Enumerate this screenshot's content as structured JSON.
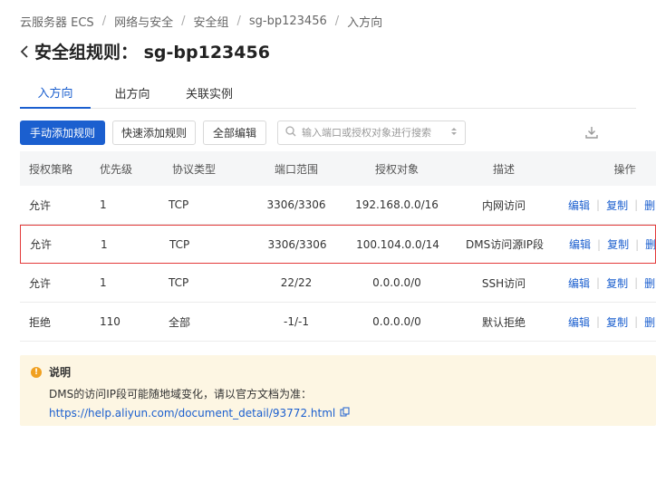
{
  "breadcrumb": [
    "云服务器 ECS",
    "网络与安全",
    "安全组",
    "sg-bp123456",
    "入方向"
  ],
  "title": "安全组规则： sg-bp123456",
  "tabs": [
    {
      "label": "入方向",
      "active": true
    },
    {
      "label": "出方向",
      "active": false
    },
    {
      "label": "关联实例",
      "active": false
    }
  ],
  "toolbar": {
    "manual_add": "手动添加规则",
    "quick_add": "快速添加规则",
    "edit_all": "全部编辑",
    "search_placeholder": "输入端口或授权对象进行搜索"
  },
  "table": {
    "headers": {
      "policy": "授权策略",
      "priority": "优先级",
      "protocol": "协议类型",
      "port": "端口范围",
      "object": "授权对象",
      "desc": "描述",
      "ops": "操作"
    },
    "rows": [
      {
        "policy": "允许",
        "priority": "1",
        "protocol": "TCP",
        "port": "3306/3306",
        "object": "192.168.0.0/16",
        "desc": "内网访问",
        "highlight": false
      },
      {
        "policy": "允许",
        "priority": "1",
        "protocol": "TCP",
        "port": "3306/3306",
        "object": "100.104.0.0/14",
        "desc": "DMS访问源IP段",
        "highlight": true
      },
      {
        "policy": "允许",
        "priority": "1",
        "protocol": "TCP",
        "port": "22/22",
        "object": "0.0.0.0/0",
        "desc": "SSH访问",
        "highlight": false
      },
      {
        "policy": "拒绝",
        "priority": "110",
        "protocol": "全部",
        "port": "-1/-1",
        "object": "0.0.0.0/0",
        "desc": "默认拒绝",
        "highlight": false
      }
    ],
    "ops": {
      "edit": "编辑",
      "copy": "复制",
      "delete": "删除"
    }
  },
  "notice": {
    "title": "说明",
    "text": "DMS的访问IP段可能随地域变化，请以官方文档为准：",
    "link": "https://help.aliyun.com/document_detail/93772.html"
  },
  "colors": {
    "primary": "#1b5fcf",
    "highlight": "#e33a3a",
    "notice_bg": "#fdf6e3",
    "notice_icon": "#f0a020"
  }
}
